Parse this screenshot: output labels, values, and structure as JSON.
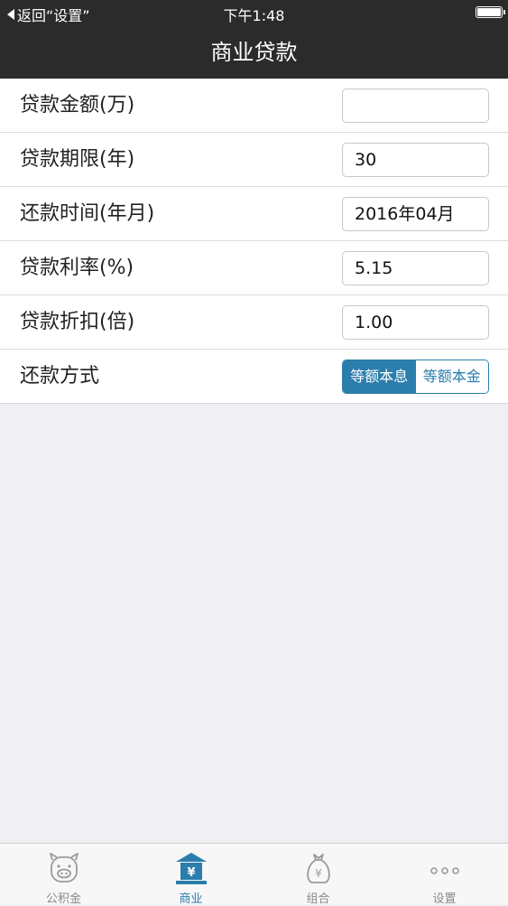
{
  "status_bar": {
    "back_label": "返回“设置”",
    "time": "下午1:48"
  },
  "header": {
    "title": "商业贷款"
  },
  "form": {
    "amount": {
      "label": "贷款金额(万)",
      "value": ""
    },
    "term": {
      "label": "贷款期限(年)",
      "value": "30"
    },
    "repay_time": {
      "label": "还款时间(年月)",
      "value": "2016年04月"
    },
    "rate": {
      "label": "贷款利率(%)",
      "value": "5.15"
    },
    "discount": {
      "label": "贷款折扣(倍)",
      "value": "1.00"
    },
    "method": {
      "label": "还款方式",
      "options": [
        "等额本息",
        "等额本金"
      ],
      "selected": "等额本息"
    }
  },
  "tabbar": {
    "items": [
      {
        "label": "公积金",
        "icon": "piggy-bank-icon"
      },
      {
        "label": "商业",
        "icon": "bank-icon",
        "active": true
      },
      {
        "label": "组合",
        "icon": "money-bag-icon"
      },
      {
        "label": "设置",
        "icon": "more-dots-icon"
      }
    ]
  },
  "colors": {
    "accent": "#2b7eac",
    "header_bg": "#2b2b2b",
    "background": "#efeff4"
  }
}
